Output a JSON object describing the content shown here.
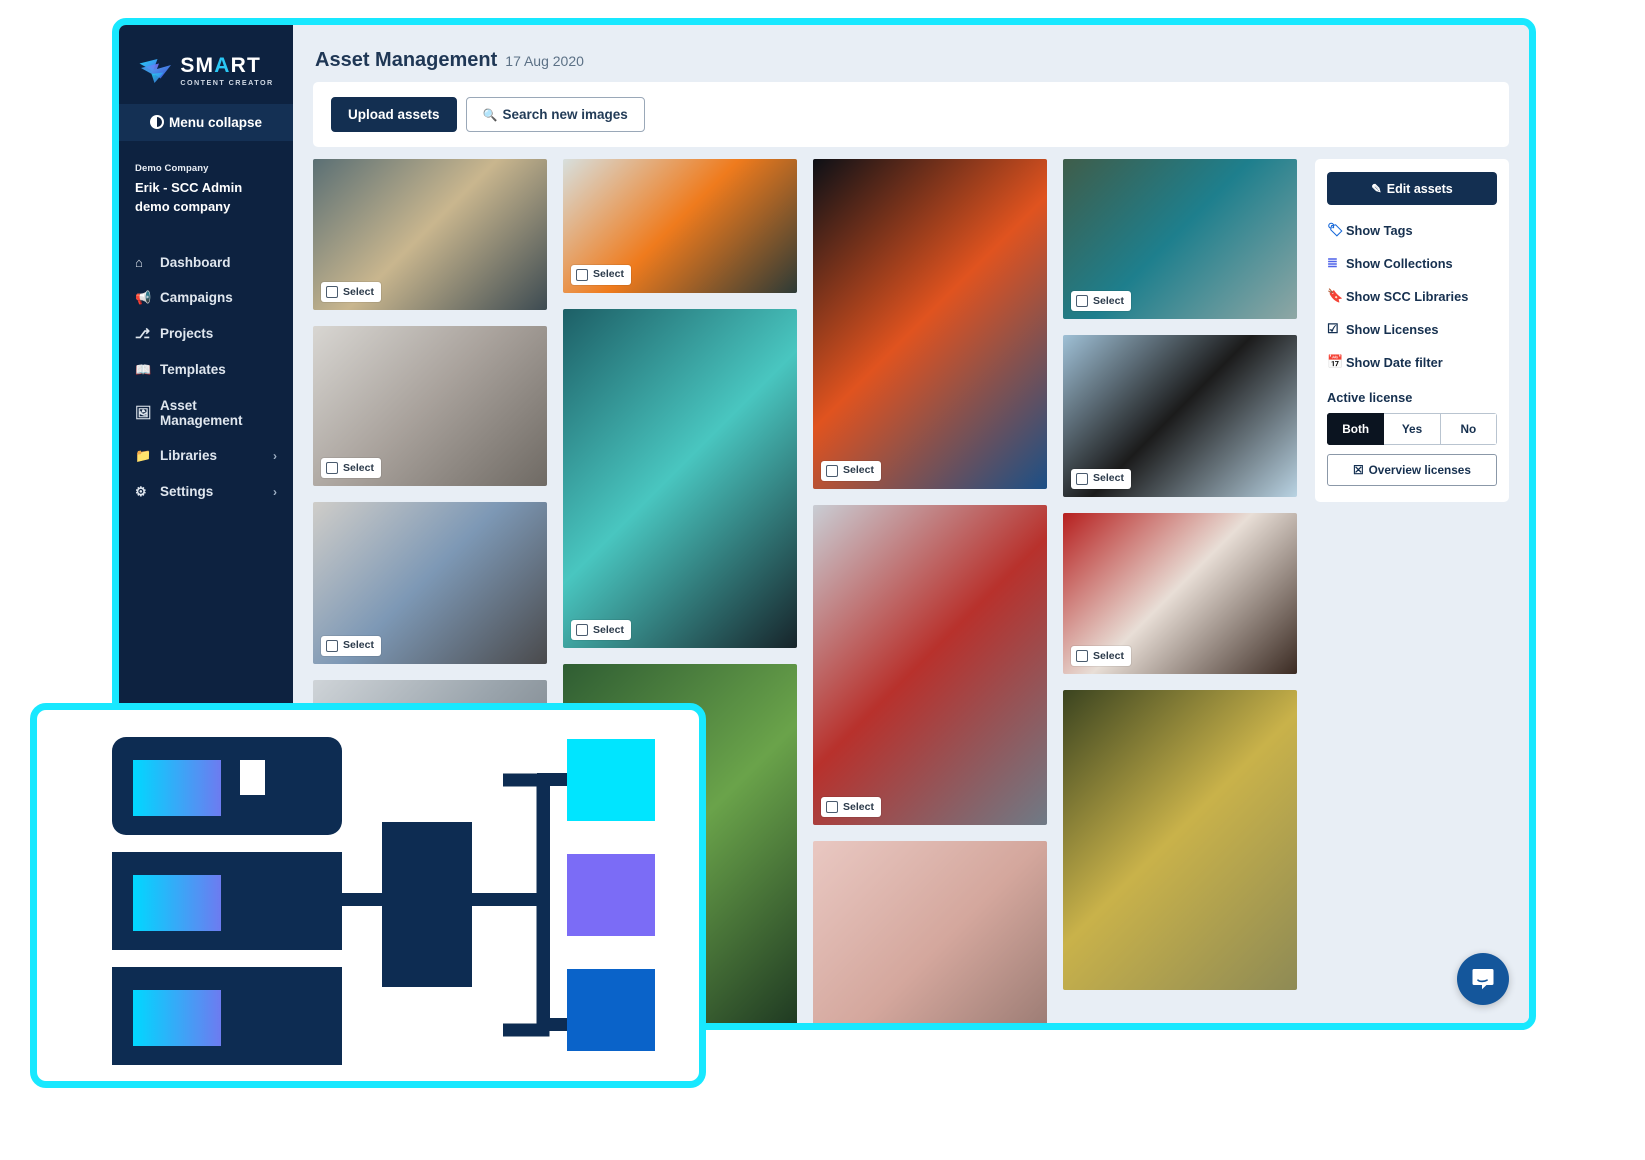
{
  "brand": {
    "name_main": "SM",
    "name_accent": "A",
    "name_tail": "RT",
    "tagline": "CONTENT CREATOR",
    "logo_icon": "hummingbird-logo"
  },
  "sidebar": {
    "menu_collapse_label": "Menu collapse",
    "company_label": "Demo Company",
    "account_name": "Erik - SCC Admin demo company",
    "items": [
      {
        "label": "Dashboard",
        "icon": "home-icon",
        "glyph": "⌂",
        "chevron": false
      },
      {
        "label": "Campaigns",
        "icon": "megaphone-icon",
        "glyph": "📢",
        "chevron": false
      },
      {
        "label": "Projects",
        "icon": "sitemap-icon",
        "glyph": "⎇",
        "chevron": false
      },
      {
        "label": "Templates",
        "icon": "book-icon",
        "glyph": "📖",
        "chevron": false
      },
      {
        "label": "Asset Management",
        "icon": "image-icon",
        "glyph": "🖼",
        "chevron": false
      },
      {
        "label": "Libraries",
        "icon": "folder-icon",
        "glyph": "📁",
        "chevron": true
      },
      {
        "label": "Settings",
        "icon": "gears-icon",
        "glyph": "⚙",
        "chevron": true
      }
    ]
  },
  "header": {
    "title": "Asset Management",
    "date": "17 Aug 2020"
  },
  "toolbar": {
    "upload_label": "Upload assets",
    "search_label": "Search new images",
    "search_icon": "magnifier-icon"
  },
  "gallery": {
    "select_label": "Select",
    "tiles": [
      {
        "id": "t1",
        "name": "woman-at-laptop-cafe",
        "alt": "Woman working on laptop by large windows",
        "col": 1,
        "aspect": 1.55,
        "select": true
      },
      {
        "id": "t2",
        "name": "woman-headphones-sofa",
        "alt": "Woman with headphones at laptop on sofa",
        "col": 1,
        "aspect": 1.46,
        "select": true
      },
      {
        "id": "t3",
        "name": "woman-red-headband-writing",
        "alt": "Woman with red headband writing notes",
        "col": 1,
        "aspect": 1.45,
        "select": true
      },
      {
        "id": "t4",
        "name": "office-desk-partial",
        "alt": "Partially visible office desk scene",
        "col": 1,
        "aspect": 1.45,
        "select": false
      },
      {
        "id": "t5",
        "name": "orange-beetle-car",
        "alt": "Orange vintage Beetle car parked",
        "col": 2,
        "aspect": 1.75,
        "select": true
      },
      {
        "id": "t6",
        "name": "forest-canopy-upward",
        "alt": "Looking up at tall forest canopy",
        "col": 2,
        "aspect": 0.69,
        "select": true
      },
      {
        "id": "t7",
        "name": "green-cliff-foliage",
        "alt": "Green foliage on a cliff face",
        "col": 2,
        "aspect": 0.62,
        "select": false
      },
      {
        "id": "t8",
        "name": "bangkok-tuktuk-neon",
        "alt": "Blue tuk-tuk under neon signs at night",
        "col": 3,
        "aspect": 0.71,
        "select": true
      },
      {
        "id": "t9",
        "name": "london-taxi-union-flags",
        "alt": "London taxi and bus under Union Jack flags",
        "col": 3,
        "aspect": 0.73,
        "select": true
      },
      {
        "id": "t10",
        "name": "paris-street-pink-sky",
        "alt": "Parisian street at dusk with pink sky",
        "col": 3,
        "aspect": 0.95,
        "select": false
      },
      {
        "id": "t11",
        "name": "limestone-bay-longboat",
        "alt": "Longtail boat among limestone karsts",
        "col": 4,
        "aspect": 1.46,
        "select": true
      },
      {
        "id": "t12",
        "name": "letter-a-on-wall",
        "alt": "Large black letter A painted on blue wall",
        "col": 4,
        "aspect": 1.45,
        "select": true
      },
      {
        "id": "t13",
        "name": "woman-red-phonebox-london",
        "alt": "Smiling woman by red telephone box",
        "col": 4,
        "aspect": 1.45,
        "select": true
      },
      {
        "id": "t14",
        "name": "sunlit-banyan-tree",
        "alt": "Sunburst through a large banyan tree",
        "col": 4,
        "aspect": 0.78,
        "select": false
      }
    ]
  },
  "filter_panel": {
    "edit_assets_label": "Edit assets",
    "edit_assets_icon": "pencil-icon",
    "items": [
      {
        "label": "Show Tags",
        "icon": "tags-icon",
        "glyph": "🏷",
        "color_class": "ico-tag"
      },
      {
        "label": "Show Collections",
        "icon": "layers-icon",
        "glyph": "≣",
        "color_class": "ico-layers"
      },
      {
        "label": "Show SCC Libraries",
        "icon": "bookmark-icon",
        "glyph": "🔖",
        "color_class": "ico-bookmark"
      },
      {
        "label": "Show Licenses",
        "icon": "check-square-icon",
        "glyph": "☑",
        "color_class": "ico-check"
      },
      {
        "label": "Show Date filter",
        "icon": "calendar-icon",
        "glyph": "📅",
        "color_class": "ico-cal"
      }
    ],
    "active_license_label": "Active license",
    "license_options": [
      "Both",
      "Yes",
      "No"
    ],
    "license_selected": "Both",
    "overview_label": "Overview licenses",
    "overview_icon": "check-square-icon"
  },
  "chat": {
    "icon": "intercom-chat-icon",
    "color": "#14569B"
  },
  "diagram": {
    "name": "asset-structure-illustration",
    "colors": {
      "navy": "#0D2C52",
      "cyan": "#00E5FF",
      "purple": "#7B6CF6",
      "blue": "#0A63C9",
      "gradient_from": "#00D8FF",
      "gradient_to": "#6D7BF0",
      "white": "#FFFFFF"
    }
  },
  "theme": {
    "accent_cyan": "#18E8FF",
    "navy": "#0D2240",
    "page_bg": "#E8EEF5",
    "button_navy": "#132F51"
  }
}
